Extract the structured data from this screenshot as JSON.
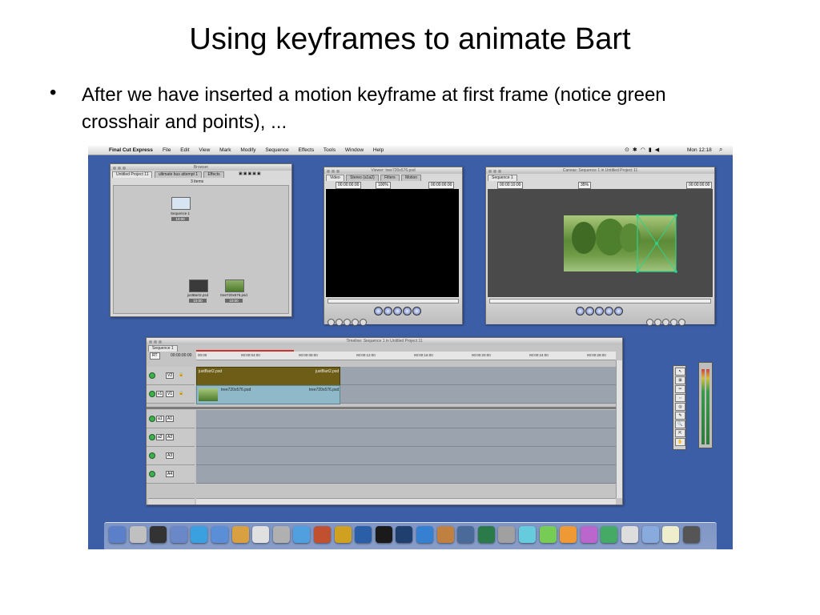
{
  "slide": {
    "title": "Using keyframes to animate Bart",
    "bullet": "After we have inserted a motion keyframe at first frame (notice green crosshair and points), ..."
  },
  "menubar": {
    "app": "Final Cut Express",
    "items": [
      "File",
      "Edit",
      "View",
      "Mark",
      "Modify",
      "Sequence",
      "Effects",
      "Tools",
      "Window",
      "Help"
    ],
    "clock": "Mon 12:18"
  },
  "browser": {
    "title": "Browser",
    "tabs": [
      "Untitled Project 11",
      "ultimate bus attempt 1",
      "Effects"
    ],
    "count": "3 items",
    "clips": [
      {
        "name": "Sequence 1",
        "duration": "10:00"
      },
      {
        "name": "justBart2.psd",
        "duration": "10:00"
      },
      {
        "name": "tree720x576.psd",
        "duration": "10:00"
      }
    ]
  },
  "viewer": {
    "title": "Viewer: tree720x576.psd",
    "tabs": [
      "Video",
      "Stereo (a1a2)",
      "Filters",
      "Motion"
    ],
    "timecode_left": "00:00:00:00",
    "zoom": "100%",
    "timecode_right": "00:00:00:00"
  },
  "canvas": {
    "title": "Canvas: Sequence 1 in Untitled Project 11",
    "tab": "Sequence 1",
    "timecode_left": "00:00:10:00",
    "zoom": "35%",
    "timecode_right": "00:00:00:00",
    "keyframe_color": "#2fd08a"
  },
  "timeline": {
    "title": "Timeline: Sequence 1 in Untitled Project 11",
    "tab": "Sequence 1",
    "rt": "RT",
    "current_time": "00:00:00:00",
    "ruler": [
      "00:00",
      "00:00:04:00",
      "00:00:08:00",
      "00:00:12:00",
      "00:00:16:00",
      "00:00:20:00",
      "00:00:24:00",
      "00:00:28:00"
    ],
    "tracks": [
      {
        "src": "",
        "dst": "V2",
        "clip": "justBart2.psd",
        "clip_end": "justBart2.psd"
      },
      {
        "src": "v1",
        "dst": "V1",
        "clip": "tree720x576.psd",
        "clip_end": "tree720x576.psd"
      },
      {
        "src": "a1",
        "dst": "A1"
      },
      {
        "src": "a2",
        "dst": "A2"
      },
      {
        "src": "",
        "dst": "A3"
      },
      {
        "src": "",
        "dst": "A4"
      }
    ],
    "colors": {
      "video_top": "#6e5d17",
      "video_bottom": "#8fb9c9"
    }
  },
  "tools": [
    "↖",
    "⊞",
    "✂",
    "⇔",
    "◎",
    "✎",
    "🔍",
    "⇱",
    "✋"
  ],
  "dock_colors": [
    "#5b7fc8",
    "#c0c0c0",
    "#333333",
    "#6a88c8",
    "#3aa0e0",
    "#5a8fd8",
    "#d8a040",
    "#e0e0e0",
    "#b0b0b0",
    "#50a0e0",
    "#c05030",
    "#d0a020",
    "#2a5fa8",
    "#1a1a1a",
    "#1f3f6f",
    "#3580d0",
    "#c08040",
    "#4a6a9a",
    "#2a7a4a",
    "#a0a0a0",
    "#66ccdd",
    "#77cc55",
    "#ee9933",
    "#bb66cc",
    "#44aa66",
    "#dddddd",
    "#88aadd",
    "#eeeecc",
    "#555555"
  ]
}
